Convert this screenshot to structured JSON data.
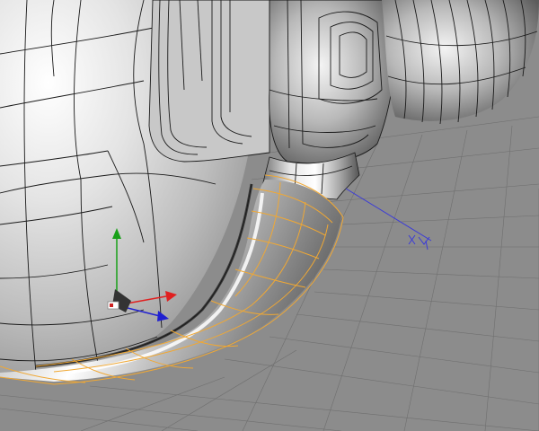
{
  "viewport": {
    "background": "#8c8c8c",
    "grid_color": "#707070",
    "selection_color": "#f0a834",
    "axis_colors": {
      "x": "#e02020",
      "y": "#18a018",
      "z": "#2020d0",
      "world_axis": "#3a3ad8"
    }
  },
  "gizmo": {
    "icon": "move-gizmo-icon",
    "axes": [
      "x",
      "y",
      "z"
    ]
  },
  "world_axis": {
    "icon": "world-axis-icon"
  }
}
